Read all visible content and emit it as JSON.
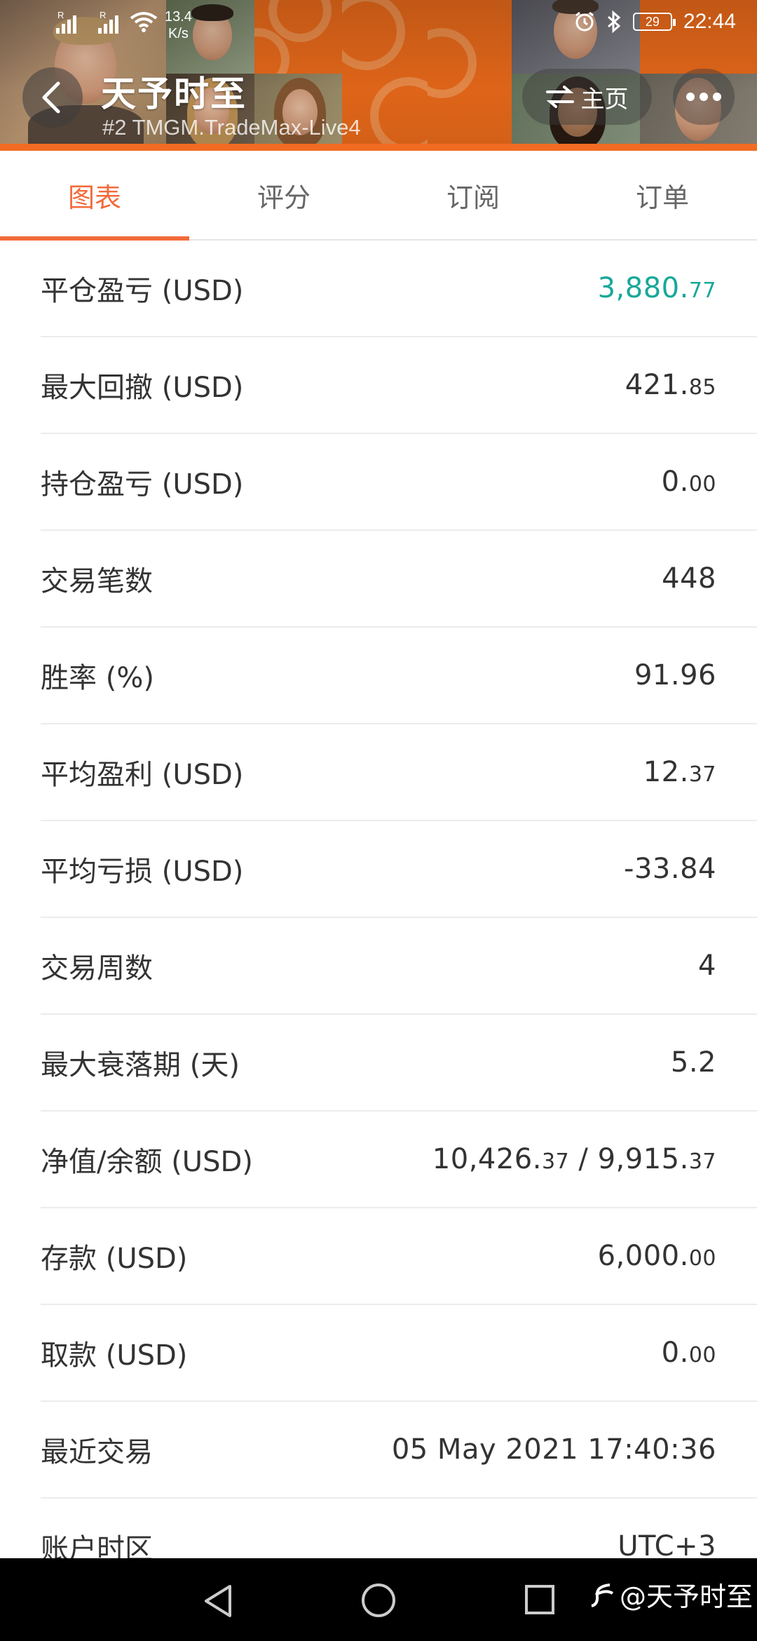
{
  "status_bar": {
    "net_speed_value": "13.4",
    "net_speed_unit": "K/s",
    "battery": "29",
    "time": "22:44"
  },
  "header": {
    "title": "天予时至",
    "subtitle": "#2   TMGM.TradeMax-Live4",
    "home_label": "主页"
  },
  "tabs": [
    {
      "label": "图表",
      "active": true
    },
    {
      "label": "评分",
      "active": false
    },
    {
      "label": "订阅",
      "active": false
    },
    {
      "label": "订单",
      "active": false
    }
  ],
  "stats": [
    {
      "label": "平仓盈亏 (USD)",
      "int": "3,880.",
      "dec": "77",
      "color": "#18a89a"
    },
    {
      "label": "最大回撤 (USD)",
      "int": "421.",
      "dec": "85"
    },
    {
      "label": "持仓盈亏 (USD)",
      "int": "0.",
      "dec": "00"
    },
    {
      "label": "交易笔数",
      "int": "448",
      "dec": ""
    },
    {
      "label": "胜率 (%)",
      "int": "91.96",
      "dec": ""
    },
    {
      "label": "平均盈利 (USD)",
      "int": "12.",
      "dec": "37"
    },
    {
      "label": "平均亏损 (USD)",
      "int": "-33.84",
      "dec": ""
    },
    {
      "label": "交易周数",
      "int": "4",
      "dec": ""
    },
    {
      "label": "最大衰落期 (天)",
      "int": "5.2",
      "dec": ""
    },
    {
      "label": "净值/余额 (USD)",
      "int": "10,426.",
      "dec": "37",
      "int2": " / 9,915.",
      "dec2": "37"
    },
    {
      "label": "存款 (USD)",
      "int": "6,000.",
      "dec": "00"
    },
    {
      "label": "取款 (USD)",
      "int": "0.",
      "dec": "00"
    },
    {
      "label": "最近交易",
      "int": "05 May 2021 17:40:36",
      "dec": ""
    },
    {
      "label": "账户时区",
      "int": "UTC+3",
      "dec": ""
    }
  ],
  "watermark": "@天予时至",
  "colors": {
    "accent": "#f26b3a",
    "profit_green": "#18a89a",
    "header_orange": "#f7701c"
  }
}
